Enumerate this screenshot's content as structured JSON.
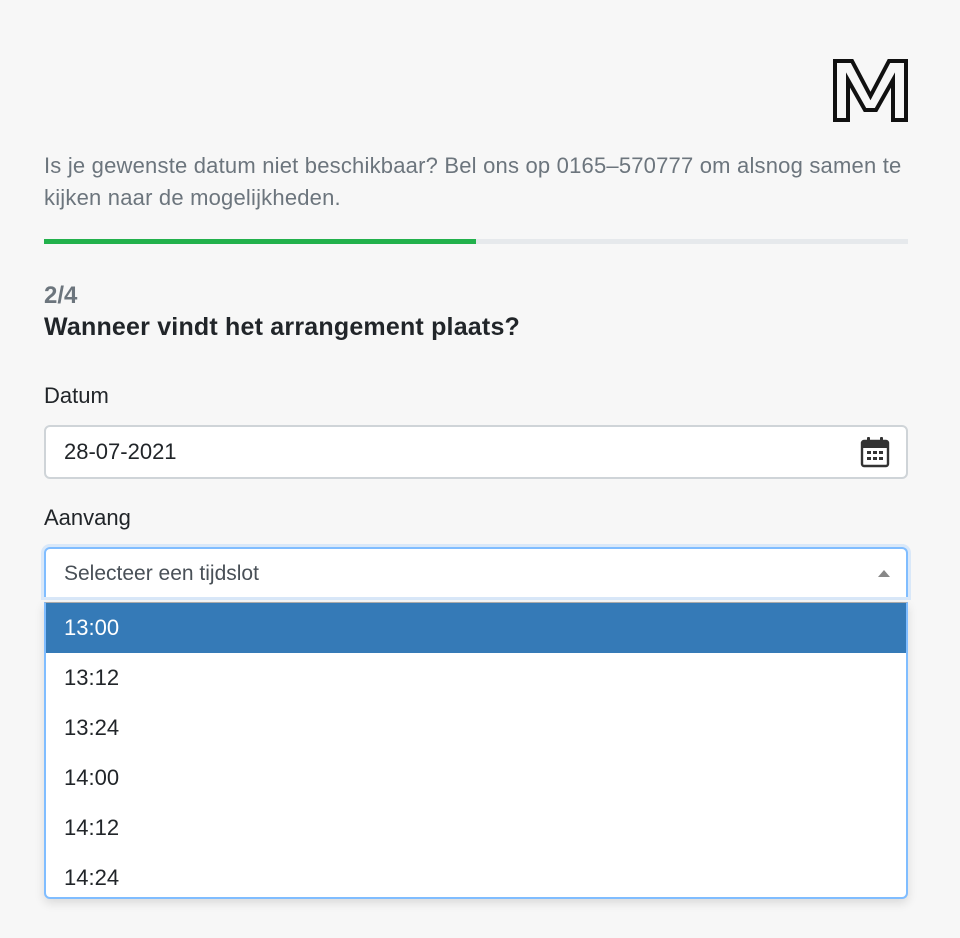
{
  "intro_text": "Is je gewenste datum niet beschikbaar? Bel ons op 0165–570777 om alsnog samen te kijken naar de mogelijkheden.",
  "progress": {
    "value": 0.5,
    "color": "#22b14c"
  },
  "step": {
    "counter": "2/4",
    "title": "Wanneer vindt het arrangement plaats?"
  },
  "date_field": {
    "label": "Datum",
    "value": "28-07-2021",
    "icon": "calendar-icon"
  },
  "time_field": {
    "label": "Aanvang",
    "placeholder": "Selecteer een tijdslot",
    "icon": "caret-up-icon",
    "options": [
      "13:00",
      "13:12",
      "13:24",
      "14:00",
      "14:12",
      "14:24"
    ],
    "highlighted": "13:00"
  },
  "colors": {
    "accent": "#357ab7",
    "focus_border": "#80bdff"
  }
}
